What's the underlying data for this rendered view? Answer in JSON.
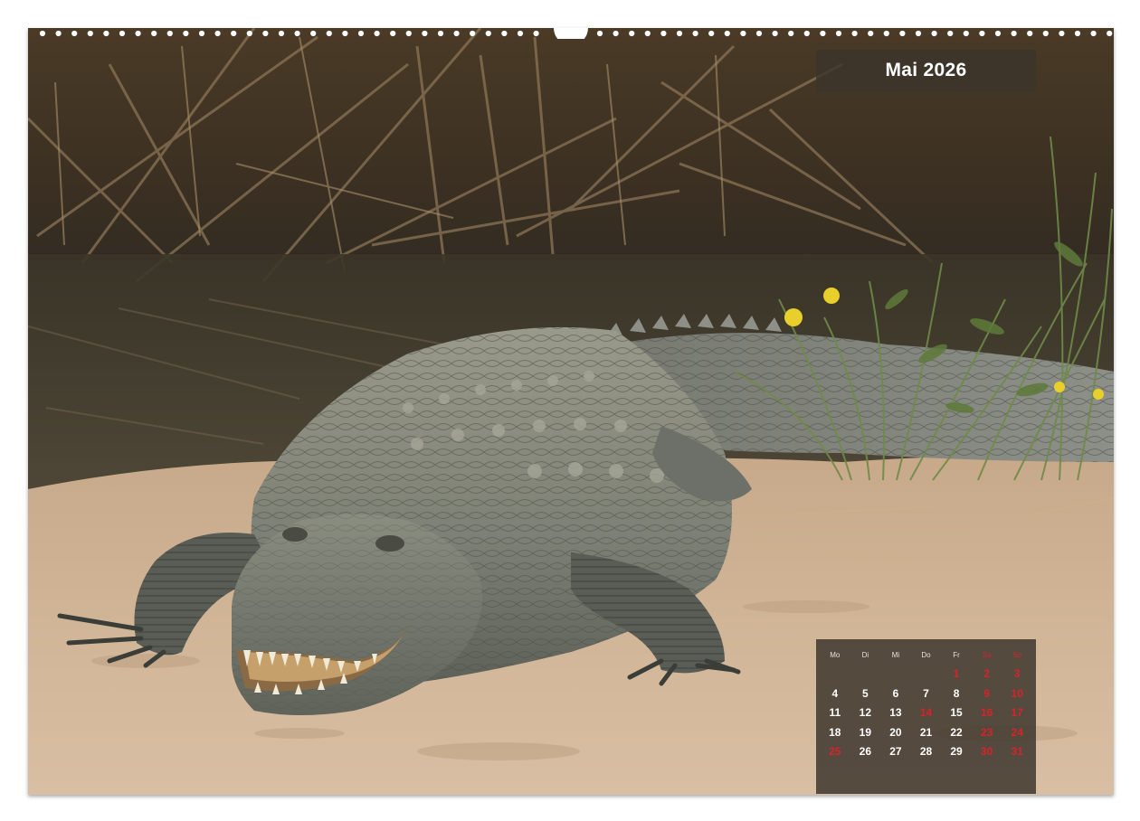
{
  "calendar": {
    "month_title": "Mai 2026",
    "weekdays": [
      "Mo",
      "Di",
      "Mi",
      "Do",
      "Fr",
      "Sa",
      "So"
    ],
    "weeks": [
      [
        "",
        "",
        "",
        "",
        "1",
        "2",
        "3"
      ],
      [
        "4",
        "5",
        "6",
        "7",
        "8",
        "9",
        "10"
      ],
      [
        "11",
        "12",
        "13",
        "14",
        "15",
        "16",
        "17"
      ],
      [
        "18",
        "19",
        "20",
        "21",
        "22",
        "23",
        "24"
      ],
      [
        "25",
        "26",
        "27",
        "28",
        "29",
        "30",
        "31"
      ]
    ],
    "holidays": [
      "1",
      "14",
      "25"
    ],
    "weekend_color": "#d8232a",
    "weekday_color": "#ffffff"
  },
  "photo": {
    "subject": "crocodile-on-sandbank"
  }
}
